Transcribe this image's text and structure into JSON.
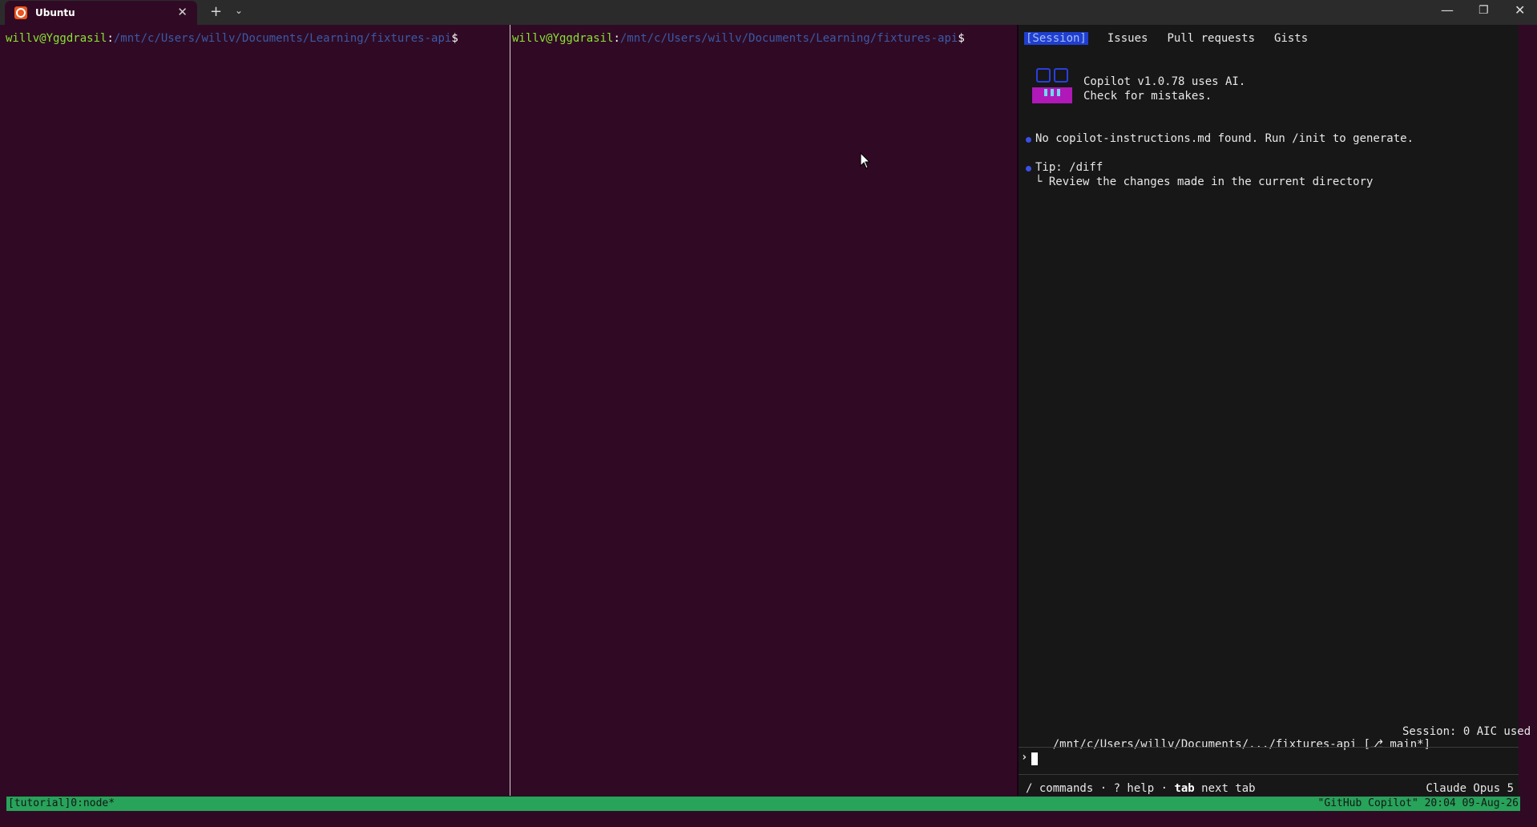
{
  "window": {
    "tab_title": "Ubuntu",
    "tab_close": "✕",
    "new_tab": "+",
    "tab_dropdown": "⌄",
    "minimize": "—",
    "restore": "❐",
    "close": "✕"
  },
  "colors": {
    "terminal_bg": "#300a24",
    "prompt_user": "#8ae234",
    "prompt_path": "#3a5aa8",
    "copilot_bg": "#171717",
    "tmux_bar": "#27a35a",
    "accent_blue": "#1f3fd0",
    "logo_magenta": "#b018b8"
  },
  "left_pane": {
    "prompt_user": "willv@Yggdrasil",
    "prompt_colon": ":",
    "prompt_path": "/mnt/c/Users/willv/Documents/Learning/fixtures-api",
    "prompt_symbol": "$"
  },
  "middle_pane": {
    "prompt_user": "willv@Yggdrasil",
    "prompt_colon": ":",
    "prompt_path": "/mnt/c/Users/willv/Documents/Learning/fixtures-api",
    "prompt_symbol": "$"
  },
  "copilot": {
    "tabs": [
      {
        "label": "[Session]",
        "active": true
      },
      {
        "label": "Issues",
        "active": false
      },
      {
        "label": "Pull requests",
        "active": false
      },
      {
        "label": "Gists",
        "active": false
      }
    ],
    "banner_line1": "Copilot v1.0.78 uses AI.",
    "banner_line2": "Check for mistakes.",
    "notice": "No copilot-instructions.md found. Run /init to generate.",
    "tip_title": "Tip: /diff",
    "tip_detail": "└ Review the changes made in the current directory",
    "status_path": "/mnt/c/Users/willv/Documents/.../fixtures-api [⎇ main*]",
    "status_session": "Session: 0 AIC used",
    "input_prompt": "›",
    "help_commands": "/ commands · ? help · ",
    "help_tab_key": "tab",
    "help_tab_text": " next tab",
    "model": "Claude Opus 5"
  },
  "tmux": {
    "left": "[tutorial]0:node*",
    "right": "\"GitHub Copilot\" 20:04 09-Aug-26"
  }
}
